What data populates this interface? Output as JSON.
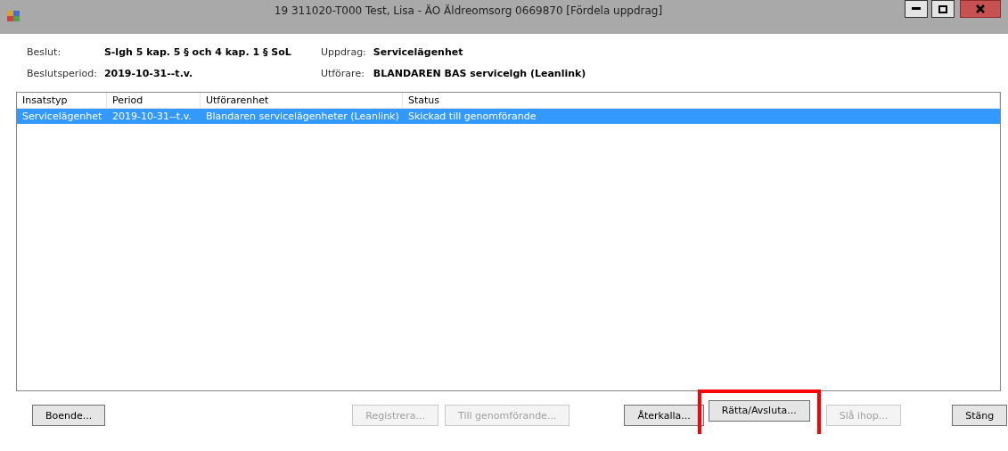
{
  "window": {
    "title": "19 311020-T000  Test, Lisa  -  ÄO Äldreomsorg  0669870  [Fördela uppdrag]"
  },
  "info": [
    {
      "label": "Beslut:",
      "value": "S-lgh 5 kap. 5 § och 4 kap. 1 § SoL"
    },
    {
      "label": "Uppdrag:",
      "value": "Servicelägenhet"
    },
    {
      "label": "Beslutsperiod:",
      "value": "2019-10-31--t.v."
    },
    {
      "label": "Utförare:",
      "value": "BLANDAREN BAS servicelgh (Leanlink)"
    }
  ],
  "table": {
    "columns": [
      "Insatstyp",
      "Period",
      "Utförarenhet",
      "Status"
    ],
    "rows": [
      {
        "cells": [
          "Servicelägenhet",
          "2019-10-31--t.v.",
          "Blandaren servicelägenheter (Leanlink)",
          "Skickad till genomförande"
        ],
        "selected": true
      }
    ]
  },
  "buttons": [
    {
      "label": "Boende...",
      "disabled": false,
      "highlighted": false
    },
    {
      "label": "Registrera...",
      "disabled": true,
      "highlighted": false
    },
    {
      "label": "Till genomförande...",
      "disabled": true,
      "highlighted": false
    },
    {
      "label": "Återkalla...",
      "disabled": false,
      "highlighted": false
    },
    {
      "label": "Rätta/Avsluta...",
      "disabled": false,
      "highlighted": true
    },
    {
      "label": "Slå ihop...",
      "disabled": true,
      "highlighted": false
    },
    {
      "label": "Stäng",
      "disabled": false,
      "highlighted": false
    }
  ]
}
